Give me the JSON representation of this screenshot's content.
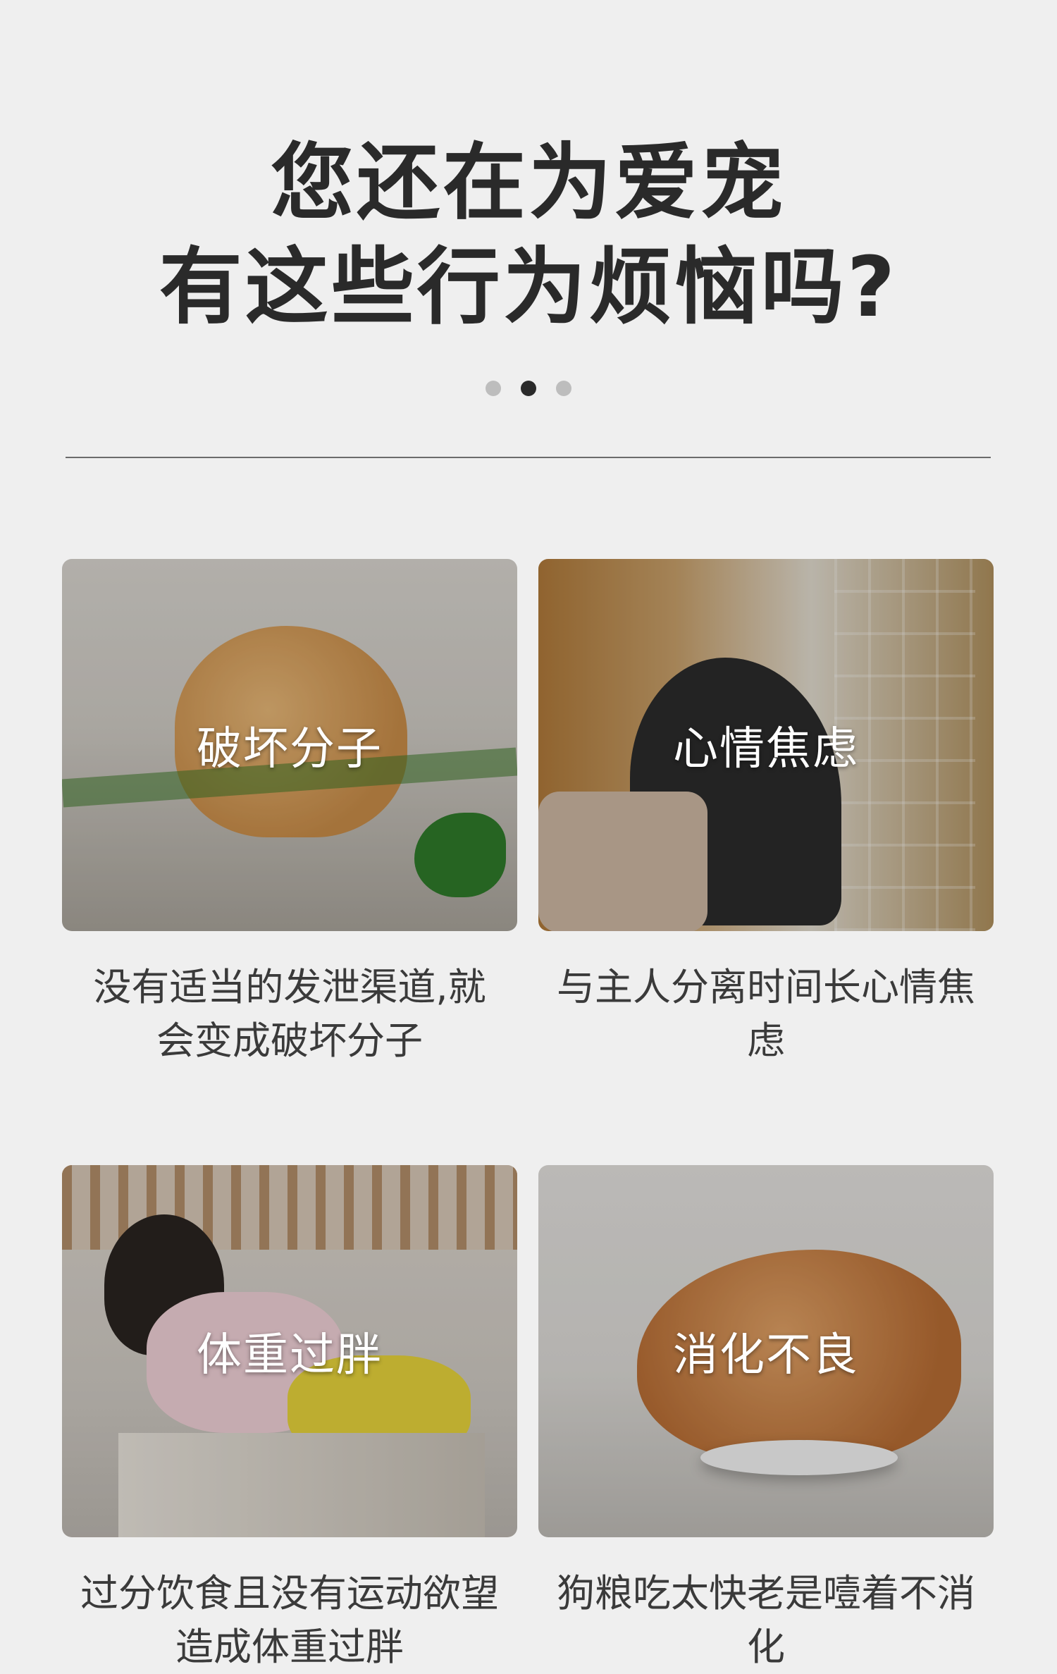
{
  "header": {
    "line1": "您还在为爱宠",
    "line2": "有这些行为烦恼吗?"
  },
  "carousel": {
    "count": 3,
    "active_index": 1
  },
  "cards": [
    {
      "label": "破坏分子",
      "desc": "没有适当的发泄渠道,就会变成破坏分子",
      "image": "dog-chewing-plant"
    },
    {
      "label": "心情焦虑",
      "desc": "与主人分离时间长心情焦虑",
      "image": "dog-looking-out-window"
    },
    {
      "label": "体重过胖",
      "desc": "过分饮食且没有运动欲望造成体重过胖",
      "image": "dachshund-on-sofa-with-snacks"
    },
    {
      "label": "消化不良",
      "desc": "狗粮吃太快老是噎着不消化",
      "image": "golden-retriever-eating"
    }
  ]
}
